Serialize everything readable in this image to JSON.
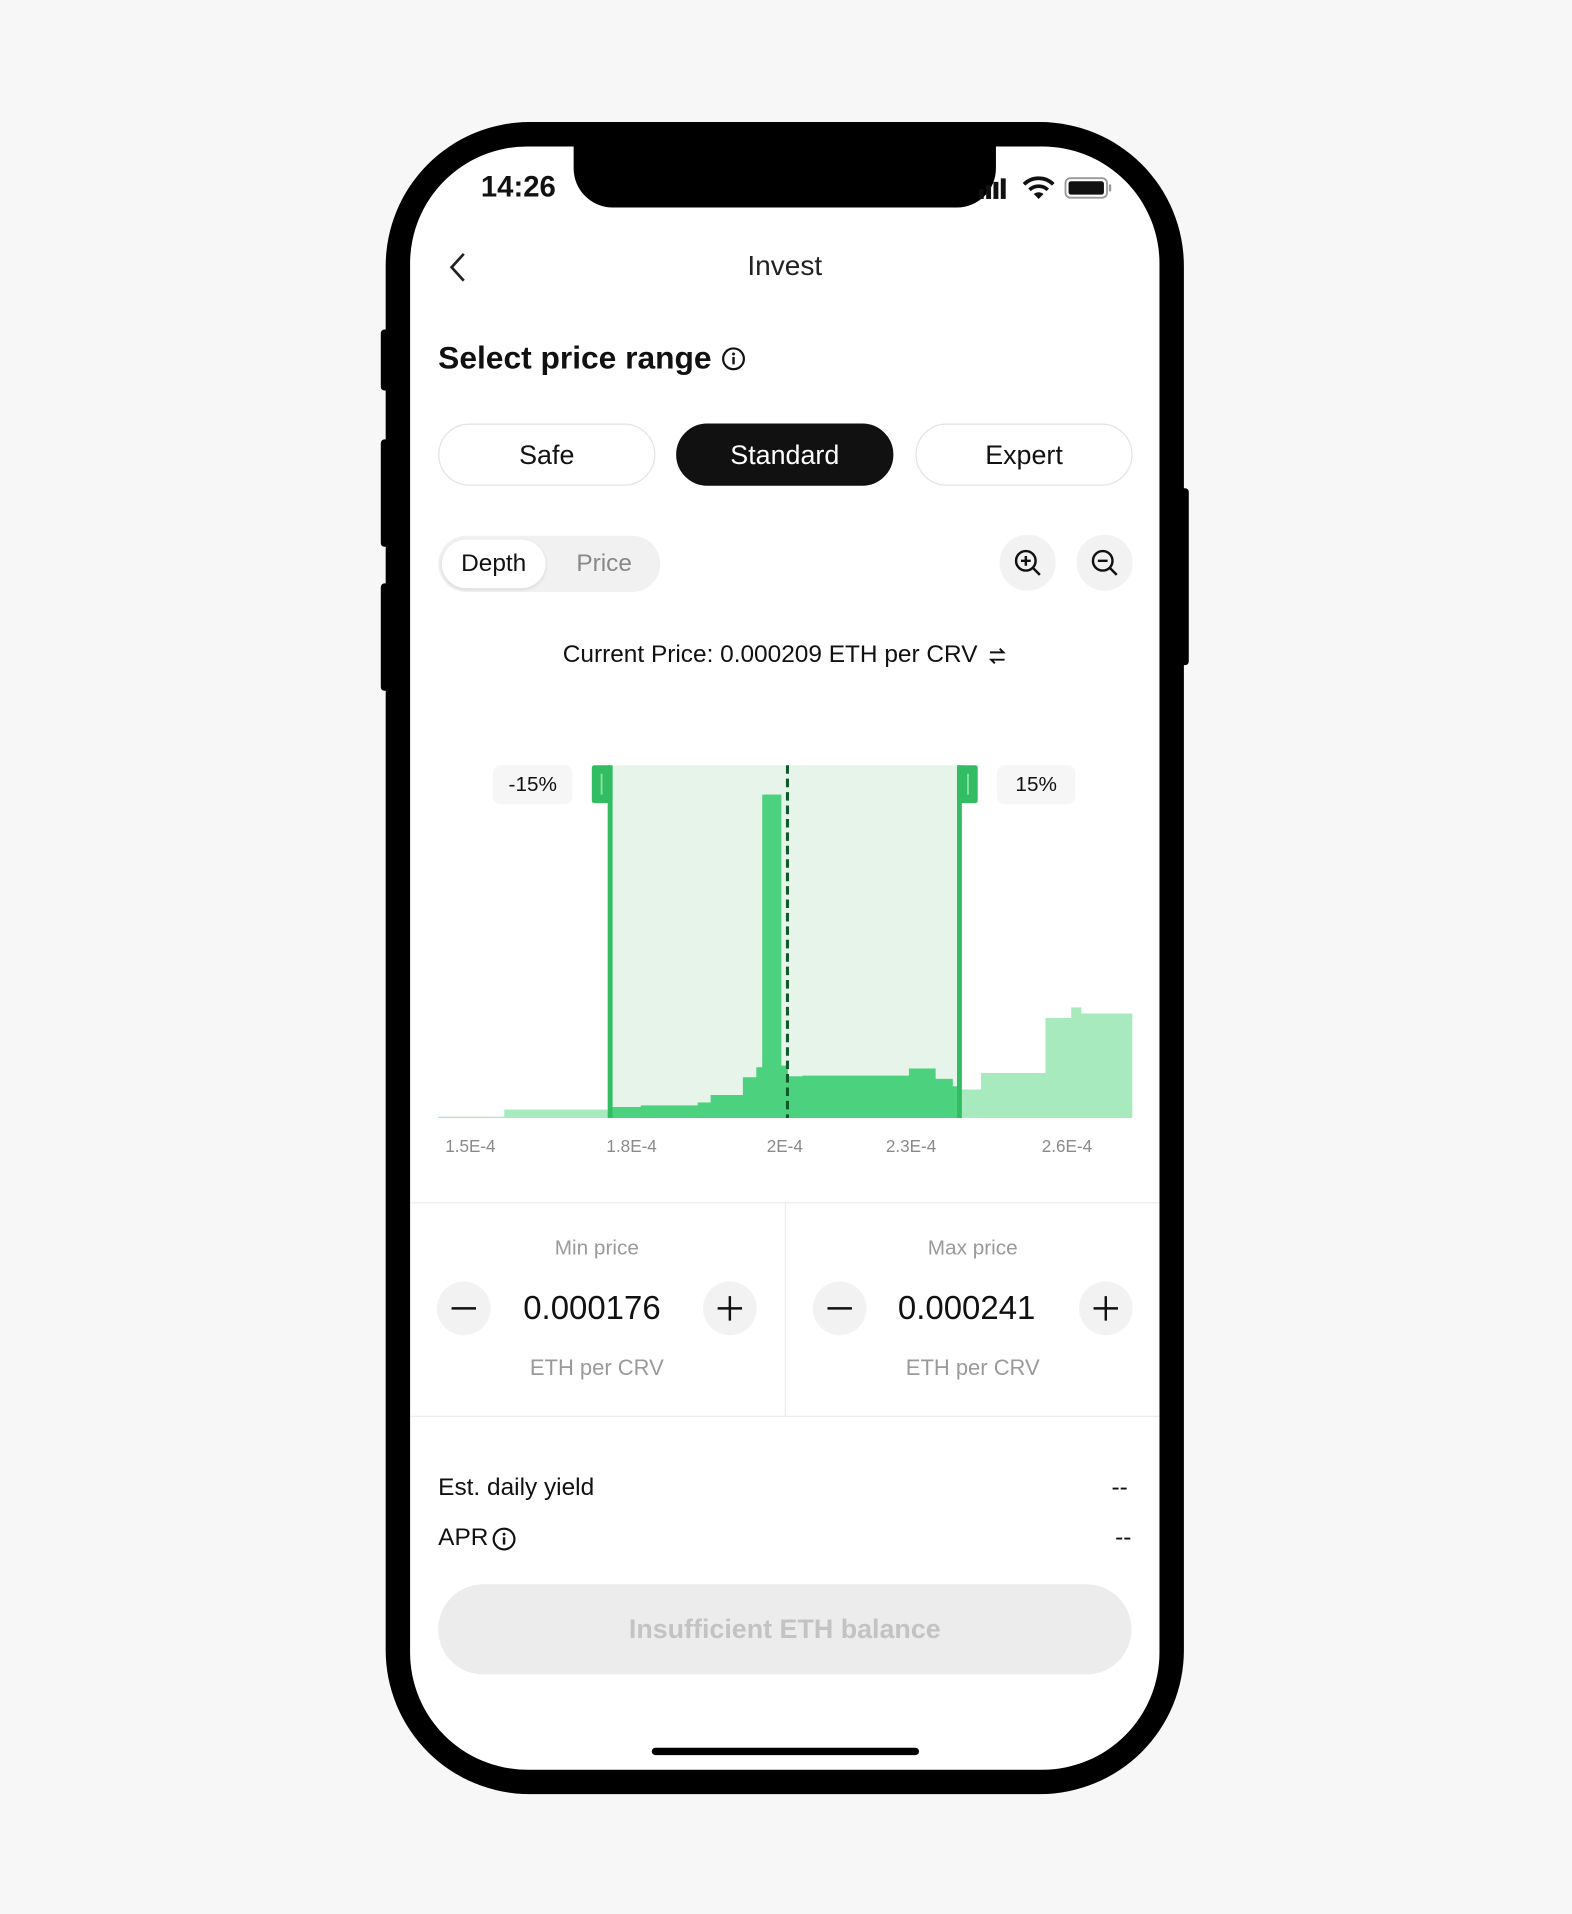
{
  "status_bar": {
    "time": "14:26",
    "icons": [
      "signal-icon",
      "wifi-icon",
      "battery-icon"
    ]
  },
  "header": {
    "title": "Invest",
    "back_icon": "chevron-left-icon"
  },
  "section": {
    "title": "Select price range",
    "info_icon": "info-icon"
  },
  "strategy_tabs": [
    {
      "label": "Safe",
      "active": false
    },
    {
      "label": "Standard",
      "active": true
    },
    {
      "label": "Expert",
      "active": false
    }
  ],
  "view_toggle": [
    {
      "label": "Depth",
      "active": true
    },
    {
      "label": "Price",
      "active": false
    }
  ],
  "zoom_buttons": {
    "zoom_in_icon": "zoom-in-icon",
    "zoom_out_icon": "zoom-out-icon"
  },
  "current_price": {
    "text": "Current Price: 0.000209 ETH per CRV",
    "swap_icon": "swap-icon"
  },
  "colors": {
    "in_range": "#4cd27e",
    "out_of_range": "#a6eabd",
    "selection": "#e7f4ea",
    "handle": "#33bd63",
    "current_line": "#0f5a2a"
  },
  "chart_data": {
    "type": "bar",
    "xlim": [
      0.000144,
      0.000273
    ],
    "x_ticks": [
      {
        "label": "1.5E-4",
        "value": 0.00015
      },
      {
        "label": "1.8E-4",
        "value": 0.00018
      },
      {
        "label": "2E-4",
        "value": 0.0002085
      },
      {
        "label": "2.3E-4",
        "value": 0.000232
      },
      {
        "label": "2.6E-4",
        "value": 0.000261
      }
    ],
    "current_price": 0.000209,
    "range": {
      "min": 0.000176,
      "max": 0.000241,
      "min_label": "-15%",
      "max_label": "15%"
    },
    "depth_relative_max": 100,
    "bars": [
      {
        "from": 0.000144,
        "to": 0.0001563,
        "depth": 0.3
      },
      {
        "from": 0.0001563,
        "to": 0.0001758,
        "depth": 2.6
      },
      {
        "from": 0.0001758,
        "to": 0.0001817,
        "depth": 3.4
      },
      {
        "from": 0.0001817,
        "to": 0.0001923,
        "depth": 3.9
      },
      {
        "from": 0.0001923,
        "to": 0.0001947,
        "depth": 4.8
      },
      {
        "from": 0.0001947,
        "to": 0.0002007,
        "depth": 7.1
      },
      {
        "from": 0.0002007,
        "to": 0.0002032,
        "depth": 12.6
      },
      {
        "from": 0.0002032,
        "to": 0.0002043,
        "depth": 15.7
      },
      {
        "from": 0.0002043,
        "to": 0.0002078,
        "depth": 100
      },
      {
        "from": 0.0002078,
        "to": 0.000209,
        "depth": 16.2
      },
      {
        "from": 0.000209,
        "to": 0.0002118,
        "depth": 12.9
      },
      {
        "from": 0.0002118,
        "to": 0.0002316,
        "depth": 13.1
      },
      {
        "from": 0.0002316,
        "to": 0.0002365,
        "depth": 15.3
      },
      {
        "from": 0.0002365,
        "to": 0.0002397,
        "depth": 12.1
      },
      {
        "from": 0.0002397,
        "to": 0.0002408,
        "depth": 9.8
      },
      {
        "from": 0.0002408,
        "to": 0.000245,
        "depth": 8.8
      },
      {
        "from": 0.000245,
        "to": 0.000257,
        "depth": 13.9
      },
      {
        "from": 0.000257,
        "to": 0.0002618,
        "depth": 30.9
      },
      {
        "from": 0.0002618,
        "to": 0.0002636,
        "depth": 34.2
      },
      {
        "from": 0.0002636,
        "to": 0.0002731,
        "depth": 32.3
      }
    ]
  },
  "min_price": {
    "label": "Min price",
    "value": "0.000176",
    "unit": "ETH per CRV"
  },
  "max_price": {
    "label": "Max price",
    "value": "0.000241",
    "unit": "ETH per CRV"
  },
  "stats": {
    "daily_yield_label": "Est. daily yield",
    "daily_yield_value": "--",
    "apr_label": "APR",
    "apr_value": "--"
  },
  "submit_button": {
    "label": "Insufficient ETH balance",
    "disabled": true
  }
}
